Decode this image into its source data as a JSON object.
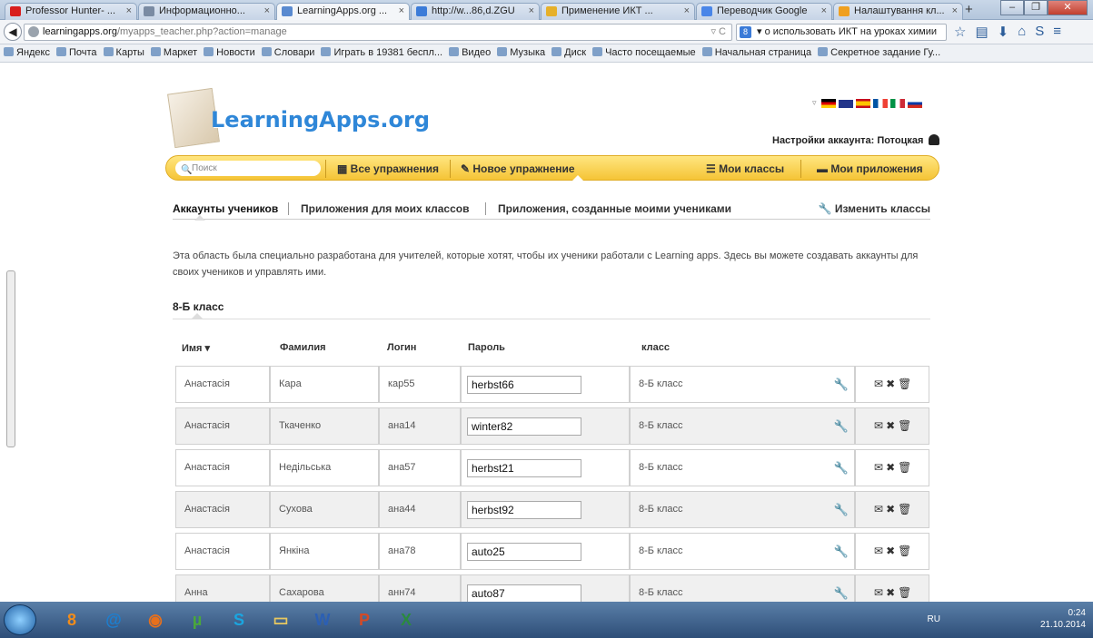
{
  "browser": {
    "tabs": [
      {
        "label": "Professor Hunter- ...",
        "icon_color": "#d81e1e"
      },
      {
        "label": "Информационно...",
        "icon_color": "#7a8ba3"
      },
      {
        "label": "LearningApps.org ...",
        "icon_color": "#5a8ad0",
        "active": true
      },
      {
        "label": "http://w...86,d.ZGU",
        "icon_color": "#3b7bd8"
      },
      {
        "label": "Применение ИКТ ...",
        "icon_color": "#e6b02a"
      },
      {
        "label": "Переводчик Google",
        "icon_color": "#4a86e8"
      },
      {
        "label": "Налаштування кл...",
        "icon_color": "#f0a020"
      }
    ],
    "tab_close": "×",
    "new_tab": "+",
    "window_buttons": [
      "–",
      "❐",
      "✕"
    ],
    "url_domain": "learningapps.org",
    "url_path": "/myapps_teacher.php?action=manage",
    "url_controls": "▿ C",
    "search_engine_glyph": "8",
    "search_text": "▾ о использовать ИКТ на уроках химии",
    "bookmarks": [
      "Яндекс",
      "Почта",
      "Карты",
      "Маркет",
      "Новости",
      "Словари",
      "Играть в 19381 беспл...",
      "Видео",
      "Музыка",
      "Диск",
      "Часто посещаемые",
      "Начальная страница",
      "Секретное задание Гу..."
    ]
  },
  "site": {
    "logo": "LearningApps.org",
    "account_label": "Настройки аккаунта: Потоцкая",
    "flags_arrow": "▿",
    "search_placeholder": "Поиск",
    "search_icon": "🔍",
    "menu": {
      "all_exercises": "Все упражнения",
      "new_exercise": "Новое упражнение",
      "my_classes": "Мои классы",
      "my_apps": "Мои приложения"
    },
    "subnav": {
      "student_accounts": "Аккаунты учеников",
      "class_apps": "Приложения для моих классов",
      "student_apps": "Приложения, созданные моими учениками",
      "edit_classes": "Изменить классы"
    },
    "intro": "Эта область была специально разработана для учителей, которые хотят, чтобы их ученики работали с Learning apps. Здесь вы можете создавать аккаунты для своих учеников и управлять ими.",
    "class_name": "8-Б класс",
    "table": {
      "headers": {
        "name": "Имя ▾",
        "surname": "Фамилия",
        "login": "Логин",
        "password": "Пароль",
        "class": "класс"
      },
      "rows": [
        {
          "name": "Анастасія",
          "surname": "Кара",
          "login": "кар55",
          "password": "herbst66",
          "class": "8-Б класс"
        },
        {
          "name": "Анастасія",
          "surname": "Ткаченко",
          "login": "ана14",
          "password": "winter82",
          "class": "8-Б класс"
        },
        {
          "name": "Анастасія",
          "surname": "Недільська",
          "login": "ана57",
          "password": "herbst21",
          "class": "8-Б класс"
        },
        {
          "name": "Анастасія",
          "surname": "Сухова",
          "login": "ана44",
          "password": "herbst92",
          "class": "8-Б класс"
        },
        {
          "name": "Анастасія",
          "surname": "Янкіна",
          "login": "ана78",
          "password": "auto25",
          "class": "8-Б класс"
        },
        {
          "name": "Анна",
          "surname": "Сахарова",
          "login": "анн74",
          "password": "auto87",
          "class": "8-Б класс"
        }
      ]
    }
  },
  "taskbar": {
    "apps": [
      {
        "icon": "ok-icon",
        "glyph": "8",
        "color": "#f28c1a"
      },
      {
        "icon": "mail-at-icon",
        "glyph": "@",
        "color": "#1b7fd1"
      },
      {
        "icon": "firefox-icon",
        "glyph": "◉",
        "color": "#e7701c"
      },
      {
        "icon": "utorrent-icon",
        "glyph": "µ",
        "color": "#4aa83a"
      },
      {
        "icon": "skype-icon",
        "glyph": "S",
        "color": "#1aa6e0"
      },
      {
        "icon": "explorer-icon",
        "glyph": "▭",
        "color": "#e8c860"
      },
      {
        "icon": "word-icon",
        "glyph": "W",
        "color": "#2b5fb4"
      },
      {
        "icon": "powerpoint-icon",
        "glyph": "P",
        "color": "#d24a26"
      },
      {
        "icon": "excel-icon",
        "glyph": "X",
        "color": "#2a8a3e"
      }
    ],
    "lang": "RU",
    "time": "0:24",
    "date": "21.10.2014"
  }
}
